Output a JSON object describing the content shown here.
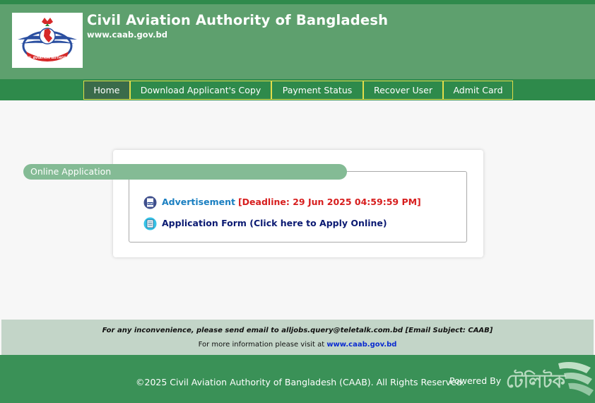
{
  "header": {
    "title": "Civil Aviation Authority of Bangladesh",
    "url": "www.caab.gov.bd",
    "logo_text": "CIVIL AVIATION AUTHORITY"
  },
  "nav": {
    "items": [
      {
        "label": "Home",
        "active": true
      },
      {
        "label": "Download Applicant's Copy",
        "active": false
      },
      {
        "label": "Payment Status",
        "active": false
      },
      {
        "label": "Recover User",
        "active": false
      },
      {
        "label": "Admit Card",
        "active": false
      }
    ]
  },
  "online_application": {
    "legend": "Online Application",
    "advertisement_label": "Advertisement",
    "deadline_text": "[Deadline: 29 Jun 2025 04:59:59 PM]",
    "apply_label": "Application Form (Click here to Apply Online)",
    "icons": {
      "advertisement": "pdf-icon",
      "apply": "form-icon"
    }
  },
  "info": {
    "contact_text": "For any inconvenience, please send email to alljobs.query@teletalk.com.bd [Email Subject: CAAB]",
    "more_info_prefix": "For more information please visit at",
    "more_info_link": "www.caab.gov.bd"
  },
  "footer": {
    "copyright": "©2025 Civil Aviation Authority of Bangladesh (CAAB). All Rights Reserved.",
    "powered_by": "Powered By"
  },
  "colors": {
    "header_green": "#5ea06e",
    "nav_green": "#2e8a4b",
    "nav_border": "#e3dd4a",
    "legend_green": "#84bb95",
    "footer_green": "#3a9157",
    "deadline_red": "#d71e1e",
    "link_blue": "#1a7fc1"
  }
}
